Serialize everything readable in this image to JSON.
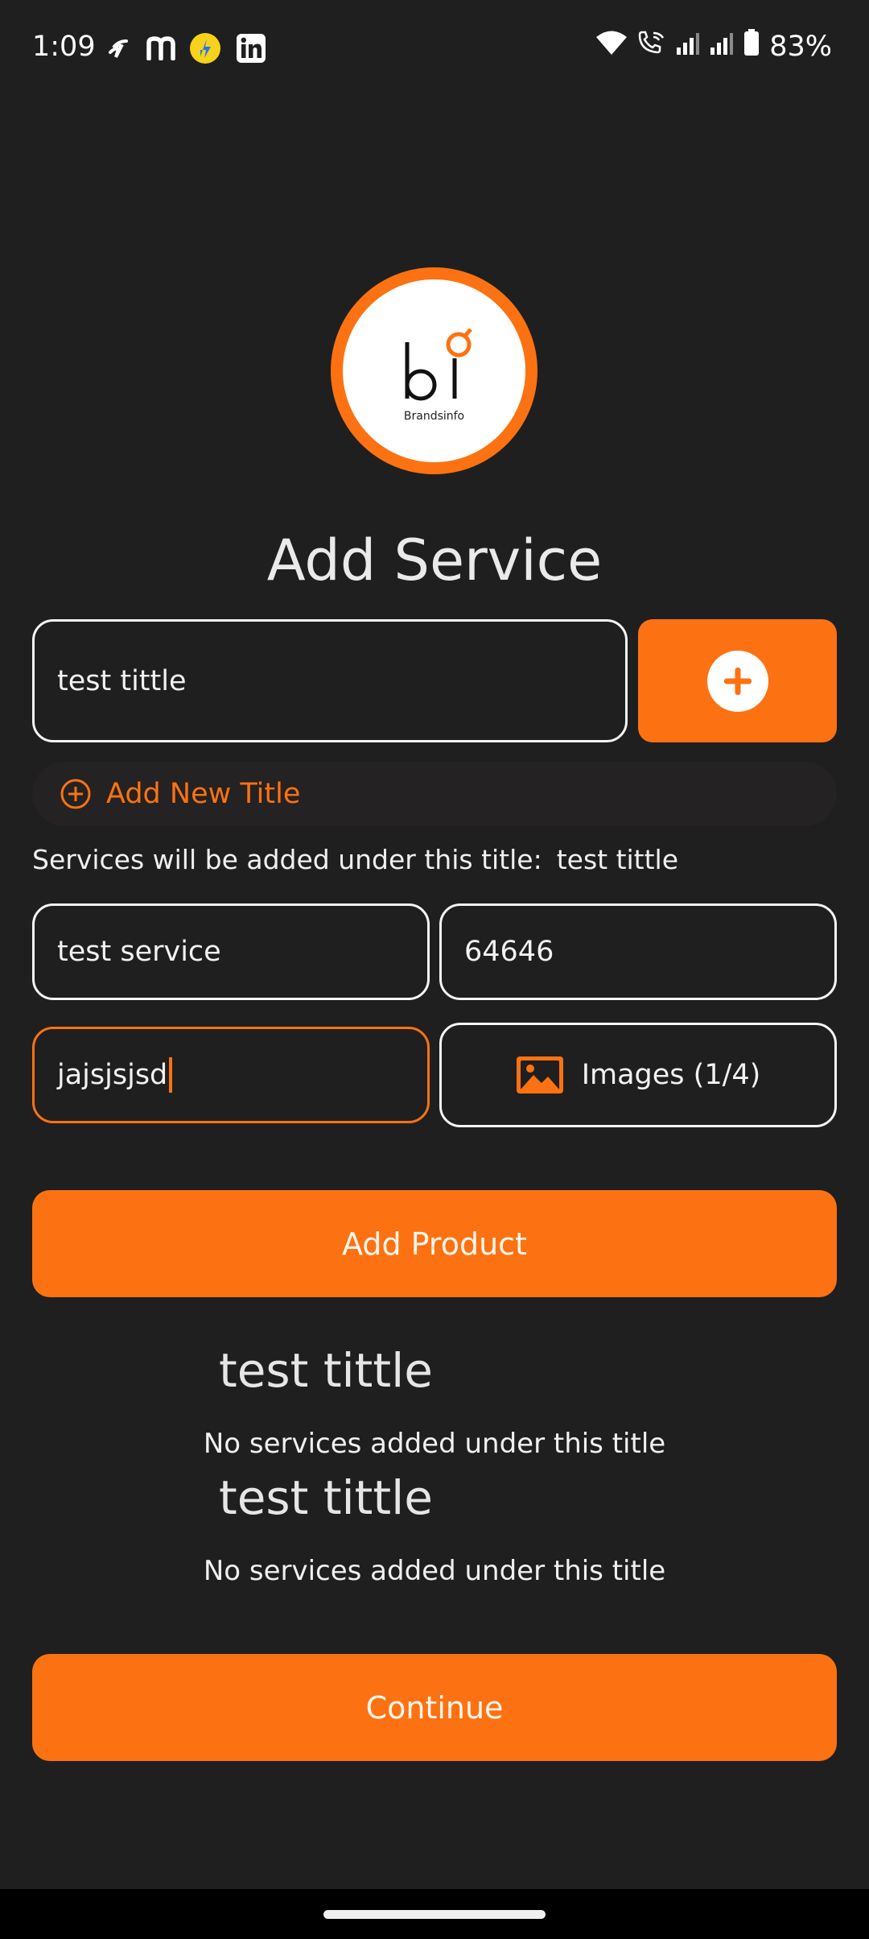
{
  "status_bar": {
    "time": "1:09",
    "battery": "83%",
    "app_icons": [
      "flipkart-bolt-icon",
      "myntra-m-icon",
      "flipkart-icon",
      "linkedin-icon"
    ],
    "system_icons": [
      "wifi-icon",
      "wifi-calling-icon",
      "signal-icon",
      "signal-icon",
      "battery-icon"
    ]
  },
  "logo": {
    "wordmark": "Brandsinfo",
    "accent": "#fc7212"
  },
  "page_title": "Add Service",
  "title_input": {
    "value": "test tittle"
  },
  "add_new_title": {
    "label": "Add New Title"
  },
  "hint": {
    "prefix": "Services will be added under this title:",
    "value": "test tittle"
  },
  "service_input": {
    "value": "test service"
  },
  "price_input": {
    "value": "64646"
  },
  "description_input": {
    "value": "jajsjsjsd"
  },
  "images_button": {
    "label": "Images (1/4)"
  },
  "add_product_button": {
    "label": "Add Product"
  },
  "groups": [
    {
      "title": "test tittle",
      "empty_text": "No services added under this title"
    },
    {
      "title": "test tittle",
      "empty_text": "No services added under this title"
    }
  ],
  "continue_button": {
    "label": "Continue"
  },
  "colors": {
    "accent": "#fc7212",
    "background": "#1f1f1f",
    "text": "#f2f2f2"
  }
}
